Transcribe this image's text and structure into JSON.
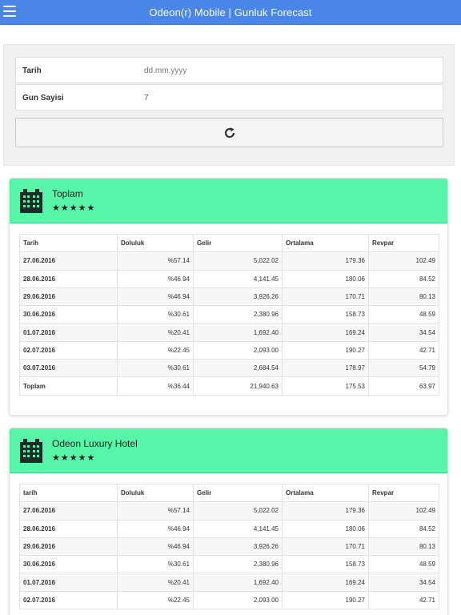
{
  "header": {
    "title": "Odeon(r) Mobile | Gunluk Forecast",
    "menu_icon": "hamburger-menu-icon"
  },
  "filters": {
    "date_label": "Tarih",
    "date_placeholder": "dd.mm.yyyy",
    "days_label": "Gun Sayisi",
    "days_value": "7",
    "refresh_icon": "refresh-icon"
  },
  "cards": [
    {
      "name": "Toplam",
      "stars": "★★★★★",
      "columns": [
        "Tarih",
        "Doluluk",
        "Gelir",
        "Ortalama",
        "Revpar"
      ],
      "rows": [
        [
          "27.06.2016",
          "%57.14",
          "5,022.02",
          "179.36",
          "102.49"
        ],
        [
          "28.06.2016",
          "%46.94",
          "4,141.45",
          "180.06",
          "84.52"
        ],
        [
          "29.06.2016",
          "%46.94",
          "3,926.26",
          "170.71",
          "80.13"
        ],
        [
          "30.06.2016",
          "%30.61",
          "2,380.96",
          "158.73",
          "48.59"
        ],
        [
          "01.07.2016",
          "%20.41",
          "1,692.40",
          "169.24",
          "34.54"
        ],
        [
          "02.07.2016",
          "%22.45",
          "2,093.00",
          "190.27",
          "42.71"
        ],
        [
          "03.07.2016",
          "%30.61",
          "2,684.54",
          "178.97",
          "54.79"
        ],
        [
          "Toplam",
          "%36.44",
          "21,940.63",
          "175.53",
          "63.97"
        ]
      ]
    },
    {
      "name": "Odeon Luxury Hotel",
      "stars": "★★★★★",
      "columns": [
        "tarih",
        "Doluluk",
        "Gelir",
        "Ortalama",
        "Revpar"
      ],
      "rows": [
        [
          "27.06.2016",
          "%57.14",
          "5,022.02",
          "179.36",
          "102.49"
        ],
        [
          "28.06.2016",
          "%46.94",
          "4,141.45",
          "180.06",
          "84.52"
        ],
        [
          "29.06.2016",
          "%46.94",
          "3,926.26",
          "170.71",
          "80.13"
        ],
        [
          "30.06.2016",
          "%30.61",
          "2,380.96",
          "158.73",
          "48.59"
        ],
        [
          "01.07.2016",
          "%20.41",
          "1,692.40",
          "169.24",
          "34.54"
        ],
        [
          "02.07.2016",
          "%22.45",
          "2,093.00",
          "190.27",
          "42.71"
        ]
      ]
    }
  ],
  "colors": {
    "header_bg": "#4a86e8",
    "card_header_bg": "#57f5a7",
    "panel_bg": "#f1f1f1"
  }
}
